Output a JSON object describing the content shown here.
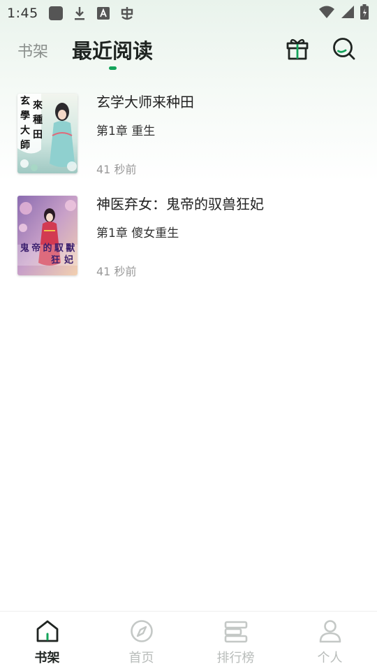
{
  "status_bar": {
    "time": "1:45",
    "icons_left": [
      "square-app-icon",
      "download-icon",
      "font-a-icon",
      "bug-app-icon"
    ],
    "icons_right": [
      "wifi-icon",
      "signal-icon",
      "battery-icon"
    ]
  },
  "header": {
    "tab_shelf": "书架",
    "tab_recent": "最近阅读",
    "active_tab": "最近阅读",
    "accent_color": "#13a35a",
    "gift_icon": "gift-icon",
    "search_icon": "search-icon"
  },
  "books": [
    {
      "title": "玄学大师来种田",
      "chapter": "第1章 重生",
      "time": "41 秒前",
      "cover_text": [
        "玄",
        "學",
        "大",
        "師",
        "來",
        "種",
        "田"
      ]
    },
    {
      "title": "神医弃女：鬼帝的驭兽狂妃",
      "chapter": "第1章 傻女重生",
      "time": "41 秒前",
      "cover_text": [
        "鬼",
        "帝",
        "的",
        "馭",
        "獸",
        "狂",
        "妃"
      ]
    }
  ],
  "bottom_nav": {
    "items": [
      {
        "label": "书架",
        "icon": "home-icon",
        "active": true
      },
      {
        "label": "首页",
        "icon": "compass-icon",
        "active": false
      },
      {
        "label": "排行榜",
        "icon": "ranking-icon",
        "active": false
      },
      {
        "label": "个人",
        "icon": "person-icon",
        "active": false
      }
    ]
  }
}
